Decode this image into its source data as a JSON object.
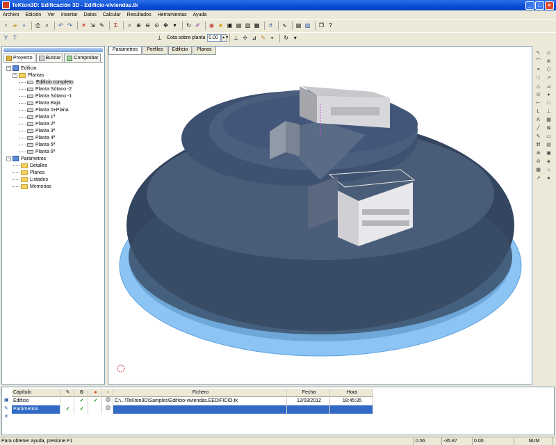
{
  "window": {
    "title": "TeKton3D: Edificación 3D - Edificio-viviendas.tk",
    "buttons": [
      "_",
      "□",
      "×"
    ]
  },
  "menu": [
    "Archivo",
    "Edición",
    "Ver",
    "Insertar",
    "Datos",
    "Calcular",
    "Resultados",
    "Herramientas",
    "Ayuda"
  ],
  "toolbar2": {
    "cota_label": "Cota sobre planta",
    "cota_value": "0.00"
  },
  "left_panel": {
    "tabs": [
      "Proyecto",
      "Buscar",
      "Comprobar"
    ],
    "tree": [
      {
        "label": "Edificio",
        "level": 0,
        "type": "blue",
        "expander": "−"
      },
      {
        "label": "Plantas",
        "level": 1,
        "type": "folder",
        "expander": "−"
      },
      {
        "label": "Edificio completo",
        "level": 2,
        "type": "plane",
        "selected": true
      },
      {
        "label": "Planta Sótano -2",
        "level": 2,
        "type": "plane"
      },
      {
        "label": "Planta Sótano -1",
        "level": 2,
        "type": "plane"
      },
      {
        "label": "Planta Baja",
        "level": 2,
        "type": "plane"
      },
      {
        "label": "Planta 0+Plana",
        "level": 2,
        "type": "plane"
      },
      {
        "label": "Planta 1ª",
        "level": 2,
        "type": "plane"
      },
      {
        "label": "Planta 2ª",
        "level": 2,
        "type": "plane"
      },
      {
        "label": "Planta 3ª",
        "level": 2,
        "type": "plane"
      },
      {
        "label": "Planta 4ª",
        "level": 2,
        "type": "plane"
      },
      {
        "label": "Planta 5ª",
        "level": 2,
        "type": "plane"
      },
      {
        "label": "Planta 6ª",
        "level": 2,
        "type": "plane"
      },
      {
        "label": "Parámetros",
        "level": 0,
        "type": "blue",
        "expander": "−"
      },
      {
        "label": "Detalles",
        "level": 1,
        "type": "folder"
      },
      {
        "label": "Planos",
        "level": 1,
        "type": "folder"
      },
      {
        "label": "Listados",
        "level": 1,
        "type": "folder"
      },
      {
        "label": "Memorias",
        "level": 1,
        "type": "folder"
      }
    ]
  },
  "viewport": {
    "tabs": [
      "Parámetros",
      "Perfiles",
      "Edificio",
      "Planos"
    ],
    "active_tab": 0,
    "colors": {
      "dome": "#2a3a55",
      "ring": "#7ab8f0",
      "building": "#d8d8d8"
    }
  },
  "bottom_table": {
    "columns": [
      "Capítulo",
      "",
      "",
      "",
      "",
      "Fichero",
      "Fecha",
      "Hora"
    ],
    "rows": [
      {
        "name": "Edificio",
        "c1": "",
        "c2": "✓",
        "c3": "✓",
        "file": "C:\\...\\TeKton3D\\Samples\\Edificio-viviendas.EEDIFICIO.tk",
        "date": "12/03/2012",
        "time": "18:45:35",
        "selected": false
      },
      {
        "name": "Parámetros",
        "c1": "✓",
        "c2": "✓",
        "c3": "",
        "file": "",
        "date": "",
        "time": "",
        "selected": true
      }
    ]
  },
  "status": {
    "hint": "Para obtener ayuda, presione F1",
    "x": "0.56",
    "y": "-35.87",
    "z": "0.00",
    "mode": "NUM"
  }
}
